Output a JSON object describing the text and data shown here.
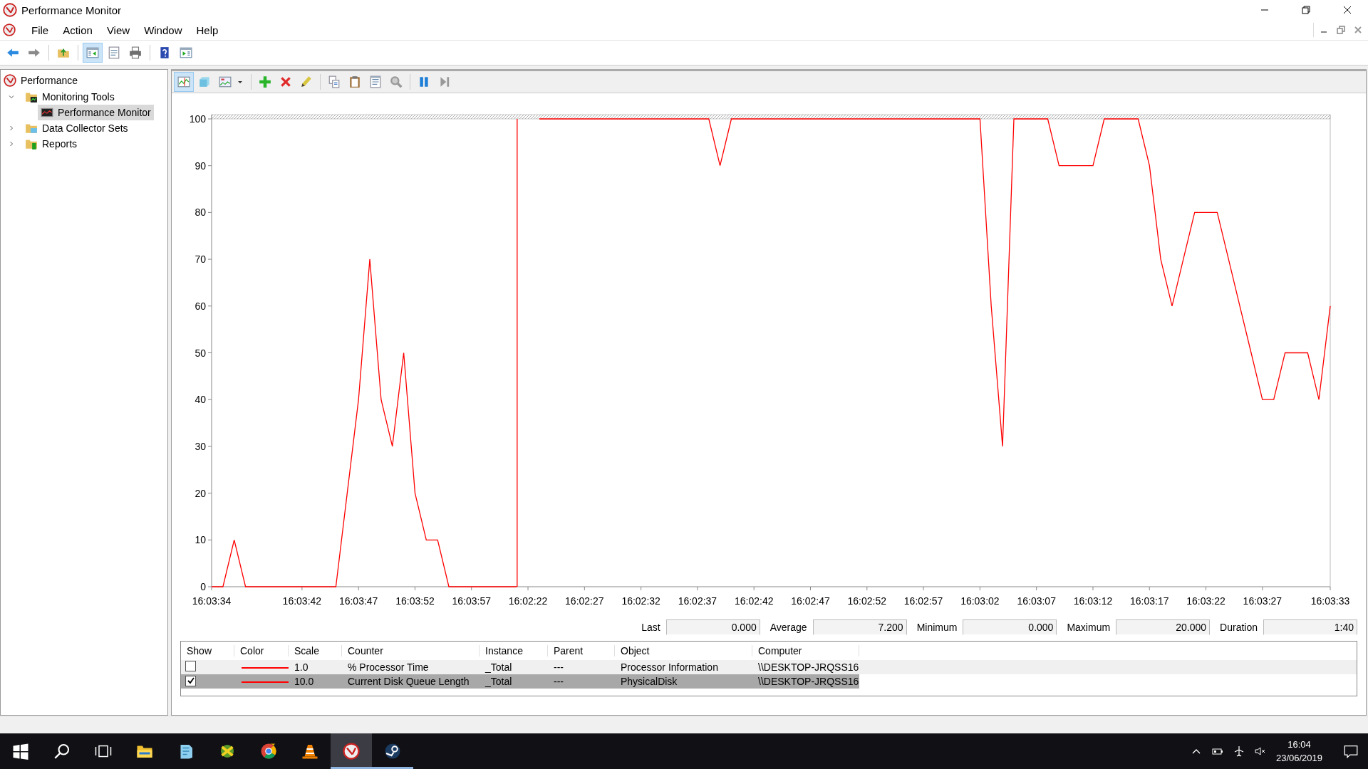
{
  "window": {
    "title": "Performance Monitor"
  },
  "menu": [
    {
      "label": "File"
    },
    {
      "label": "Action"
    },
    {
      "label": "View"
    },
    {
      "label": "Window"
    },
    {
      "label": "Help"
    }
  ],
  "toolbar": [
    {
      "kind": "back",
      "on": false
    },
    {
      "kind": "forward",
      "on": false
    },
    {
      "kind": "up",
      "on": false
    },
    {
      "kind": "tree",
      "on": true
    },
    {
      "kind": "properties",
      "on": false
    },
    {
      "kind": "print",
      "on": false
    },
    {
      "kind": "help",
      "on": false
    },
    {
      "kind": "actionpane",
      "on": false
    }
  ],
  "tree": [
    {
      "label": "Performance",
      "kind": "perf",
      "selected": false,
      "children": [
        {
          "label": "Monitoring Tools",
          "kind": "folder-monitor",
          "expanded": true,
          "selected": false,
          "children": [
            {
              "label": "Performance Monitor",
              "kind": "monitor",
              "selected": true
            }
          ]
        },
        {
          "label": "Data Collector Sets",
          "kind": "folder-collector",
          "expanded": false,
          "selected": false
        },
        {
          "label": "Reports",
          "kind": "folder-reports",
          "expanded": false,
          "selected": false
        }
      ]
    }
  ],
  "chart_toolbar": [
    {
      "kind": "graph",
      "on": true
    },
    {
      "kind": "histogram",
      "on": false
    },
    {
      "kind": "graphtype",
      "on": false
    },
    {
      "kind": "add",
      "on": false
    },
    {
      "kind": "delete",
      "on": false
    },
    {
      "kind": "highlight",
      "on": false
    },
    {
      "kind": "copy",
      "on": false
    },
    {
      "kind": "paste",
      "on": false
    },
    {
      "kind": "props",
      "on": false
    },
    {
      "kind": "zoom",
      "on": false
    },
    {
      "kind": "freeze",
      "on": false
    },
    {
      "kind": "update",
      "on": false
    }
  ],
  "graph": {
    "chart_data": {
      "type": "line",
      "ylim": [
        0,
        100
      ],
      "yticks": [
        0,
        10,
        20,
        30,
        40,
        50,
        60,
        70,
        80,
        90,
        100
      ],
      "categories": [
        "16:03:34",
        null,
        null,
        null,
        null,
        null,
        null,
        null,
        "16:03:42",
        null,
        null,
        null,
        null,
        "16:03:47",
        null,
        null,
        null,
        null,
        "16:03:52",
        null,
        null,
        null,
        null,
        "16:03:57",
        null,
        null,
        null,
        null,
        "16:02:22",
        null,
        null,
        null,
        null,
        "16:02:27",
        null,
        null,
        null,
        null,
        "16:02:32",
        null,
        null,
        null,
        null,
        "16:02:37",
        null,
        null,
        null,
        null,
        "16:02:42",
        null,
        null,
        null,
        null,
        "16:02:47",
        null,
        null,
        null,
        null,
        "16:02:52",
        null,
        null,
        null,
        null,
        "16:02:57",
        null,
        null,
        null,
        null,
        "16:03:02",
        null,
        null,
        null,
        null,
        "16:03:07",
        null,
        null,
        null,
        null,
        "16:03:12",
        null,
        null,
        null,
        null,
        "16:03:17",
        null,
        null,
        null,
        null,
        "16:03:22",
        null,
        null,
        null,
        null,
        "16:03:27",
        null,
        null,
        null,
        null,
        null,
        "16:03:33"
      ],
      "series": [
        {
          "color": "#ff0000",
          "values": [
            0,
            0,
            10,
            0,
            0,
            0,
            0,
            0,
            0,
            0,
            0,
            0,
            20,
            40,
            70,
            40,
            30,
            50,
            20,
            10,
            10,
            0,
            0,
            0,
            0,
            0,
            0,
            0,
            null,
            100,
            100,
            100,
            100,
            100,
            100,
            100,
            100,
            100,
            100,
            100,
            100,
            100,
            100,
            100,
            100,
            90,
            100,
            100,
            100,
            100,
            100,
            100,
            100,
            100,
            100,
            100,
            100,
            100,
            100,
            100,
            100,
            100,
            100,
            100,
            100,
            100,
            100,
            100,
            100,
            60,
            30,
            100,
            100,
            100,
            100,
            90,
            90,
            90,
            90,
            100,
            100,
            100,
            100,
            90,
            70,
            60,
            70,
            80,
            80,
            80,
            70,
            60,
            50,
            40,
            40,
            50,
            50,
            50,
            40,
            60
          ]
        }
      ]
    }
  },
  "stats": [
    {
      "label": "Last",
      "value": "0.000"
    },
    {
      "label": "Average",
      "value": "7.200"
    },
    {
      "label": "Minimum",
      "value": "0.000"
    },
    {
      "label": "Maximum",
      "value": "20.000"
    },
    {
      "label": "Duration",
      "value": "1:40"
    }
  ],
  "counters": {
    "columns": [
      "Show",
      "Color",
      "Scale",
      "Counter",
      "Instance",
      "Parent",
      "Object",
      "Computer"
    ],
    "rows": [
      {
        "show": false,
        "selected": false,
        "color": "#ff0000",
        "scale": "1.0",
        "counter": "% Processor Time",
        "instance": "_Total",
        "parent": "---",
        "object": "Processor Information",
        "computer": "\\\\DESKTOP-JRQSS16"
      },
      {
        "show": true,
        "selected": true,
        "color": "#ff0000",
        "scale": "10.0",
        "counter": "Current Disk Queue Length",
        "instance": "_Total",
        "parent": "---",
        "object": "PhysicalDisk",
        "computer": "\\\\DESKTOP-JRQSS16"
      }
    ]
  },
  "taskbar": {
    "apps": [
      {
        "kind": "start",
        "active": false,
        "running": false
      },
      {
        "kind": "search",
        "active": false,
        "running": false
      },
      {
        "kind": "taskview",
        "active": false,
        "running": false
      },
      {
        "kind": "explorer",
        "active": false,
        "running": false
      },
      {
        "kind": "notes",
        "active": false,
        "running": false
      },
      {
        "kind": "greenapp",
        "active": false,
        "running": false
      },
      {
        "kind": "chrome",
        "active": false,
        "running": false
      },
      {
        "kind": "vlc",
        "active": false,
        "running": false
      },
      {
        "kind": "perfmon",
        "active": true,
        "running": true
      },
      {
        "kind": "steam",
        "active": false,
        "running": true
      }
    ],
    "time": "16:04",
    "date": "23/06/2019"
  }
}
